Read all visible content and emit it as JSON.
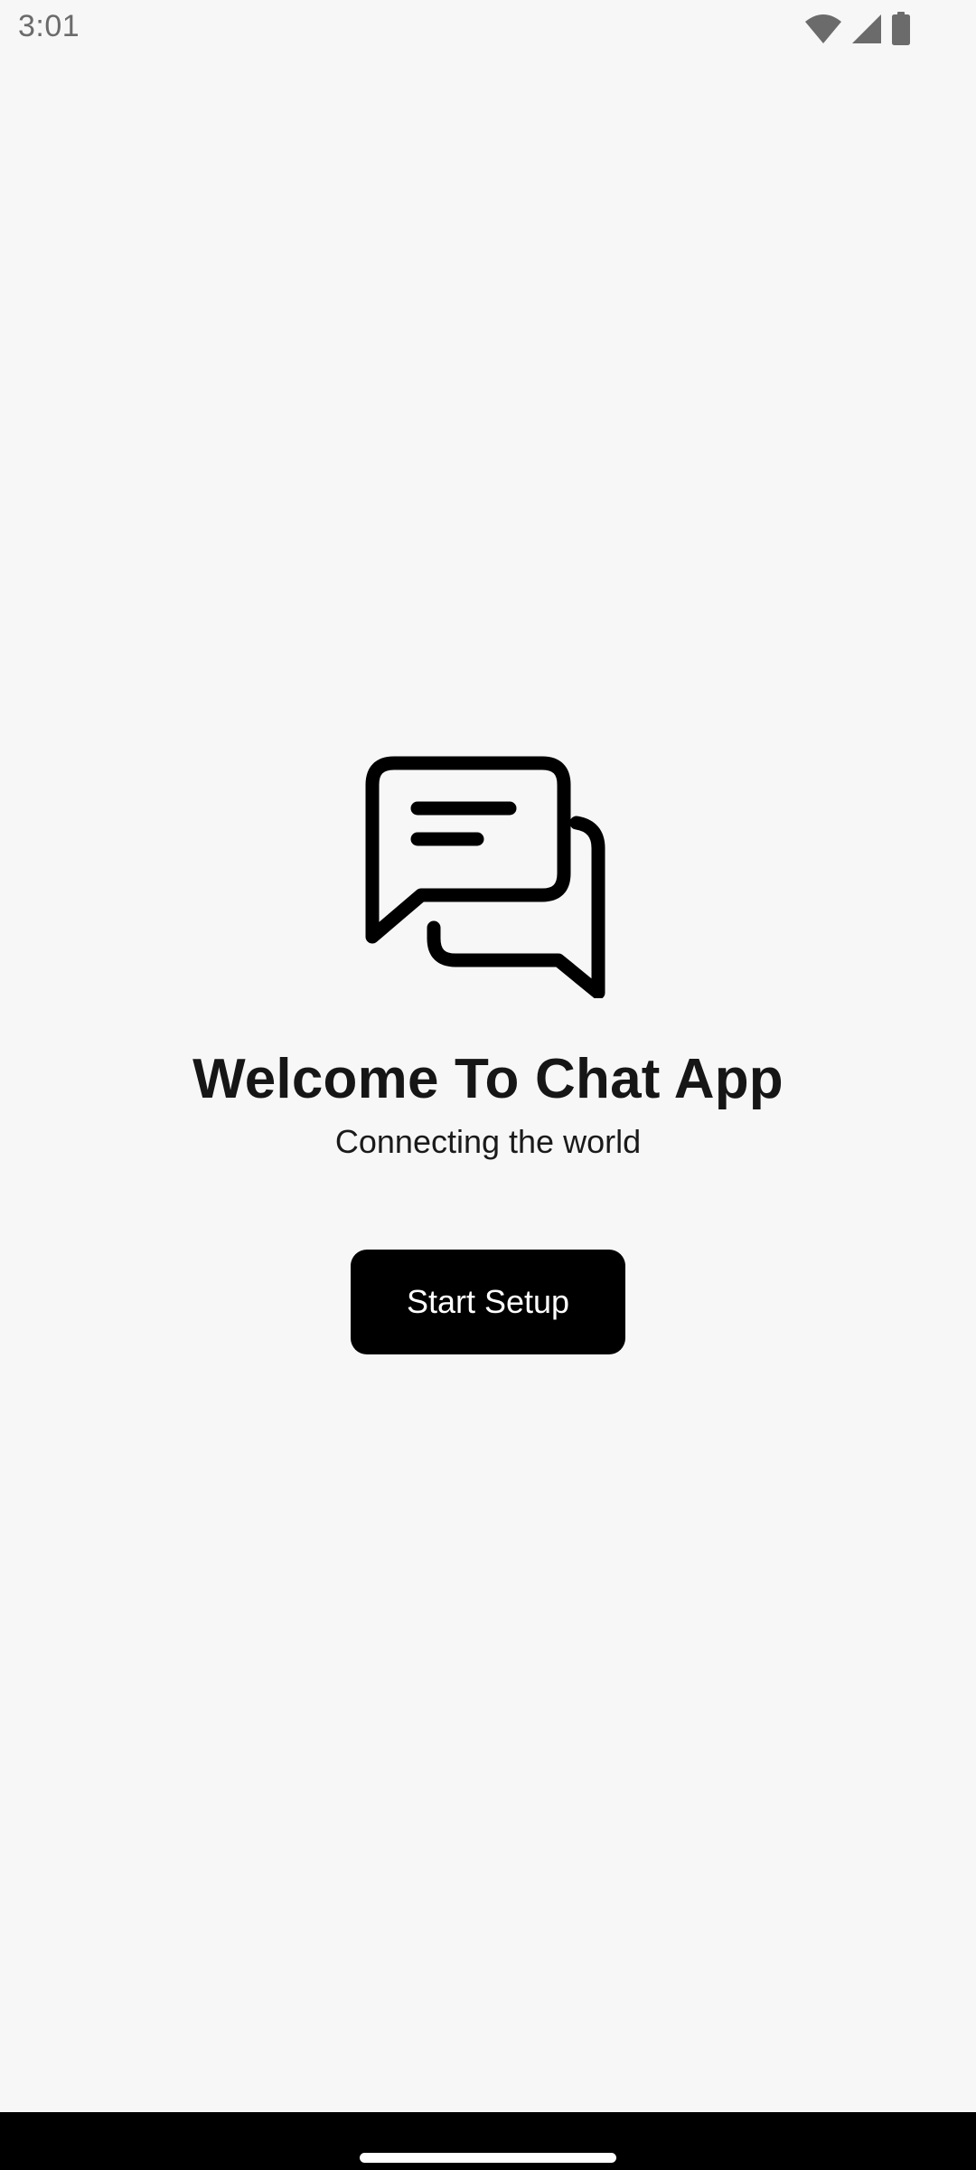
{
  "status_bar": {
    "time": "3:01",
    "icons": [
      "wifi-icon",
      "cellular-signal-icon",
      "battery-icon"
    ]
  },
  "welcome": {
    "logo_icon": "chat-bubbles-icon",
    "title": "Welcome To Chat App",
    "subtitle": "Connecting the world",
    "start_button_label": "Start Setup"
  },
  "colors": {
    "background": "#f7f7f7",
    "button_background": "#000000",
    "button_text": "#ffffff",
    "title_text": "#161616",
    "nav_bar": "#000000"
  }
}
